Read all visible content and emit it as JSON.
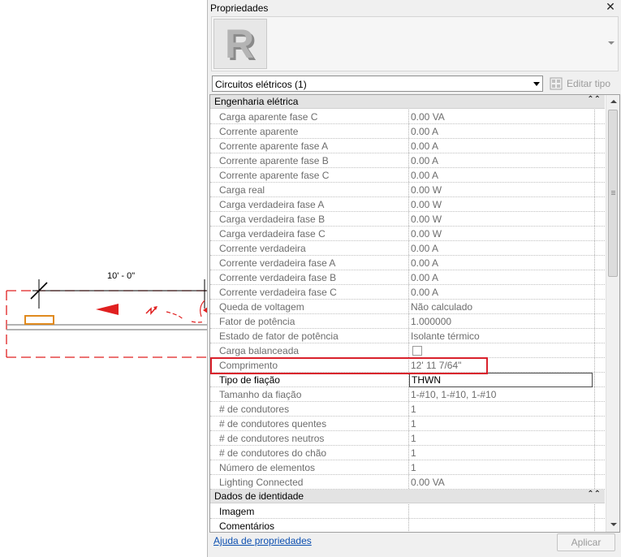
{
  "canvas": {
    "dimension_label": "10' - 0\""
  },
  "palette": {
    "title": "Propriedades",
    "close_icon": "close-icon",
    "type_selector": "Circuitos elétricos (1)",
    "edit_type_label": "Editar tipo",
    "help_link": "Ajuda de propriedades",
    "apply_label": "Aplicar"
  },
  "groups": [
    {
      "label": "Engenharia elétrica",
      "toggle": "⌃⌃"
    },
    {
      "label": "Dados de identidade",
      "toggle": "⌃⌃"
    }
  ],
  "properties": [
    {
      "name": "Carga aparente fase C",
      "value": "0.00 VA"
    },
    {
      "name": "Corrente aparente",
      "value": "0.00 A"
    },
    {
      "name": "Corrente aparente fase A",
      "value": "0.00 A"
    },
    {
      "name": "Corrente aparente fase B",
      "value": "0.00 A"
    },
    {
      "name": "Corrente aparente fase C",
      "value": "0.00 A"
    },
    {
      "name": "Carga real",
      "value": "0.00 W"
    },
    {
      "name": "Carga verdadeira fase A",
      "value": "0.00 W"
    },
    {
      "name": "Carga verdadeira fase B",
      "value": "0.00 W"
    },
    {
      "name": "Carga verdadeira fase C",
      "value": "0.00 W"
    },
    {
      "name": "Corrente verdadeira",
      "value": "0.00 A"
    },
    {
      "name": "Corrente verdadeira fase A",
      "value": "0.00 A"
    },
    {
      "name": "Corrente verdadeira fase B",
      "value": "0.00 A"
    },
    {
      "name": "Corrente verdadeira fase C",
      "value": "0.00 A"
    },
    {
      "name": "Queda de voltagem",
      "value": "Não calculado"
    },
    {
      "name": "Fator de potência",
      "value": "1.000000"
    },
    {
      "name": "Estado de fator de potência",
      "value": "Isolante térmico"
    },
    {
      "name": "Carga balanceada",
      "value": ""
    },
    {
      "name": "Comprimento",
      "value": "12'  11 7/64\""
    },
    {
      "name": "Tipo de fiação",
      "value": "THWN"
    },
    {
      "name": "Tamanho da fiação",
      "value": "1-#10, 1-#10, 1-#10"
    },
    {
      "name": "# de condutores",
      "value": "1"
    },
    {
      "name": "# de condutores quentes",
      "value": "1"
    },
    {
      "name": "# de condutores neutros",
      "value": "1"
    },
    {
      "name": "# de condutores do chão",
      "value": "1"
    },
    {
      "name": "Número de elementos",
      "value": "1"
    },
    {
      "name": "Lighting Connected",
      "value": "0.00 VA"
    }
  ],
  "identity_properties": [
    {
      "name": "Imagem",
      "value": ""
    },
    {
      "name": "Comentários",
      "value": ""
    }
  ],
  "colors": {
    "selection_red": "#e02020",
    "highlight_red": "#d9212c",
    "panel_orange": "#e08a1e",
    "link_blue": "#0b4fb0"
  }
}
